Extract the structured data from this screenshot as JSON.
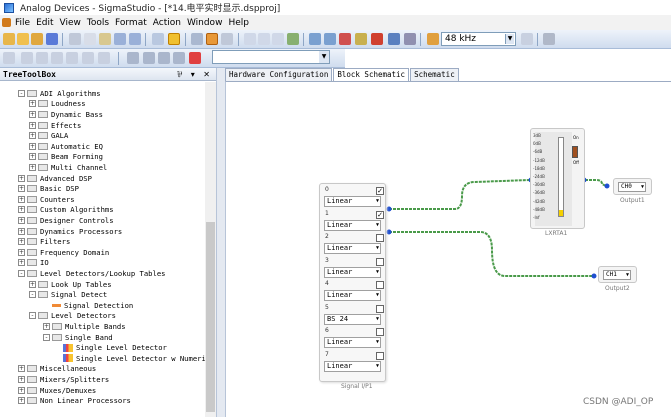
{
  "window": {
    "title": "Analog Devices - SigmaStudio - [*14.电平实时显示.dspproj]"
  },
  "menu": [
    "File",
    "Edit",
    "View",
    "Tools",
    "Format",
    "Action",
    "Window",
    "Help"
  ],
  "toolbar": {
    "sample_rate": "48 kHz"
  },
  "toolbox": {
    "title": "TreeToolBox",
    "controls": "⅌ ▾ ✕",
    "items": [
      {
        "label": "ADI Algorithms",
        "level": 0,
        "expander": "-",
        "icon": "folder"
      },
      {
        "label": "Loudness",
        "level": 1,
        "expander": "+",
        "icon": "folder"
      },
      {
        "label": "Dynamic Bass",
        "level": 1,
        "expander": "+",
        "icon": "folder"
      },
      {
        "label": "Effects",
        "level": 1,
        "expander": "+",
        "icon": "folder"
      },
      {
        "label": "GALA",
        "level": 1,
        "expander": "+",
        "icon": "folder"
      },
      {
        "label": "Automatic EQ",
        "level": 1,
        "expander": "+",
        "icon": "folder"
      },
      {
        "label": "Beam Forming",
        "level": 1,
        "expander": "+",
        "icon": "folder"
      },
      {
        "label": "Multi Channel",
        "level": 1,
        "expander": "+",
        "icon": "folder"
      },
      {
        "label": "Advanced DSP",
        "level": 0,
        "expander": "+",
        "icon": "folder"
      },
      {
        "label": "Basic DSP",
        "level": 0,
        "expander": "+",
        "icon": "folder"
      },
      {
        "label": "Counters",
        "level": 0,
        "expander": "+",
        "icon": "folder"
      },
      {
        "label": "Custom Algorithms",
        "level": 0,
        "expander": "+",
        "icon": "folder"
      },
      {
        "label": "Designer Controls",
        "level": 0,
        "expander": "+",
        "icon": "folder"
      },
      {
        "label": "Dynamics Processors",
        "level": 0,
        "expander": "+",
        "icon": "folder"
      },
      {
        "label": "Filters",
        "level": 0,
        "expander": "+",
        "icon": "folder"
      },
      {
        "label": "Frequency Domain",
        "level": 0,
        "expander": "+",
        "icon": "folder"
      },
      {
        "label": "IO",
        "level": 0,
        "expander": "+",
        "icon": "folder"
      },
      {
        "label": "Level Detectors/Lookup Tables",
        "level": 0,
        "expander": "-",
        "icon": "folder"
      },
      {
        "label": "Look Up Tables",
        "level": 1,
        "expander": "+",
        "icon": "folder"
      },
      {
        "label": "Signal Detect",
        "level": 1,
        "expander": "-",
        "icon": "folder"
      },
      {
        "label": "Signal Detection",
        "level": 2,
        "expander": "",
        "icon": "signal"
      },
      {
        "label": "Level Detectors",
        "level": 1,
        "expander": "-",
        "icon": "folder"
      },
      {
        "label": "Multiple Bands",
        "level": 2,
        "expander": "+",
        "icon": "folder"
      },
      {
        "label": "Single Band",
        "level": 2,
        "expander": "-",
        "icon": "folder"
      },
      {
        "label": "Single Level Detector",
        "level": 3,
        "expander": "",
        "icon": "meter"
      },
      {
        "label": "Single Level Detector w Numerica",
        "level": 3,
        "expander": "",
        "icon": "meter"
      },
      {
        "label": "Miscellaneous",
        "level": 0,
        "expander": "+",
        "icon": "folder"
      },
      {
        "label": "Mixers/Splitters",
        "level": 0,
        "expander": "+",
        "icon": "folder"
      },
      {
        "label": "Muxes/Demuxes",
        "level": 0,
        "expander": "+",
        "icon": "folder"
      },
      {
        "label": "Non Linear Processors",
        "level": 0,
        "expander": "+",
        "icon": "folder"
      }
    ]
  },
  "tabs": [
    "Hardware Configuration",
    "Block Schematic",
    "Schematic"
  ],
  "active_tab": 1,
  "signal_block": {
    "caption": "Signal I/P1",
    "channels": [
      {
        "num": "0",
        "mode": "Linear",
        "checked": true
      },
      {
        "num": "1",
        "mode": "Linear",
        "checked": true
      },
      {
        "num": "2",
        "mode": "Linear",
        "checked": false
      },
      {
        "num": "3",
        "mode": "Linear",
        "checked": false
      },
      {
        "num": "4",
        "mode": "Linear",
        "checked": false
      },
      {
        "num": "5",
        "mode": "BS 24",
        "checked": false
      },
      {
        "num": "6",
        "mode": "Linear",
        "checked": false
      },
      {
        "num": "7",
        "mode": "Linear",
        "checked": false
      }
    ]
  },
  "meter_block": {
    "caption": "LXRTA1",
    "scale": [
      "3dB",
      "0dB",
      "-6dB",
      "-12dB",
      "-18dB",
      "-24dB",
      "-30dB",
      "-36dB",
      "-42dB",
      "-48dB",
      "-Inf"
    ],
    "on_label": "On",
    "off_label": "Off"
  },
  "outputs": [
    {
      "channel": "CH0",
      "caption": "Output1"
    },
    {
      "channel": "CH1",
      "caption": "Output2"
    }
  ],
  "watermark": "CSDN @ADI_OP",
  "colors": {
    "wire": "#4a9a4a",
    "port": "#1f4fd0",
    "toolbar": "#cfdcee"
  }
}
